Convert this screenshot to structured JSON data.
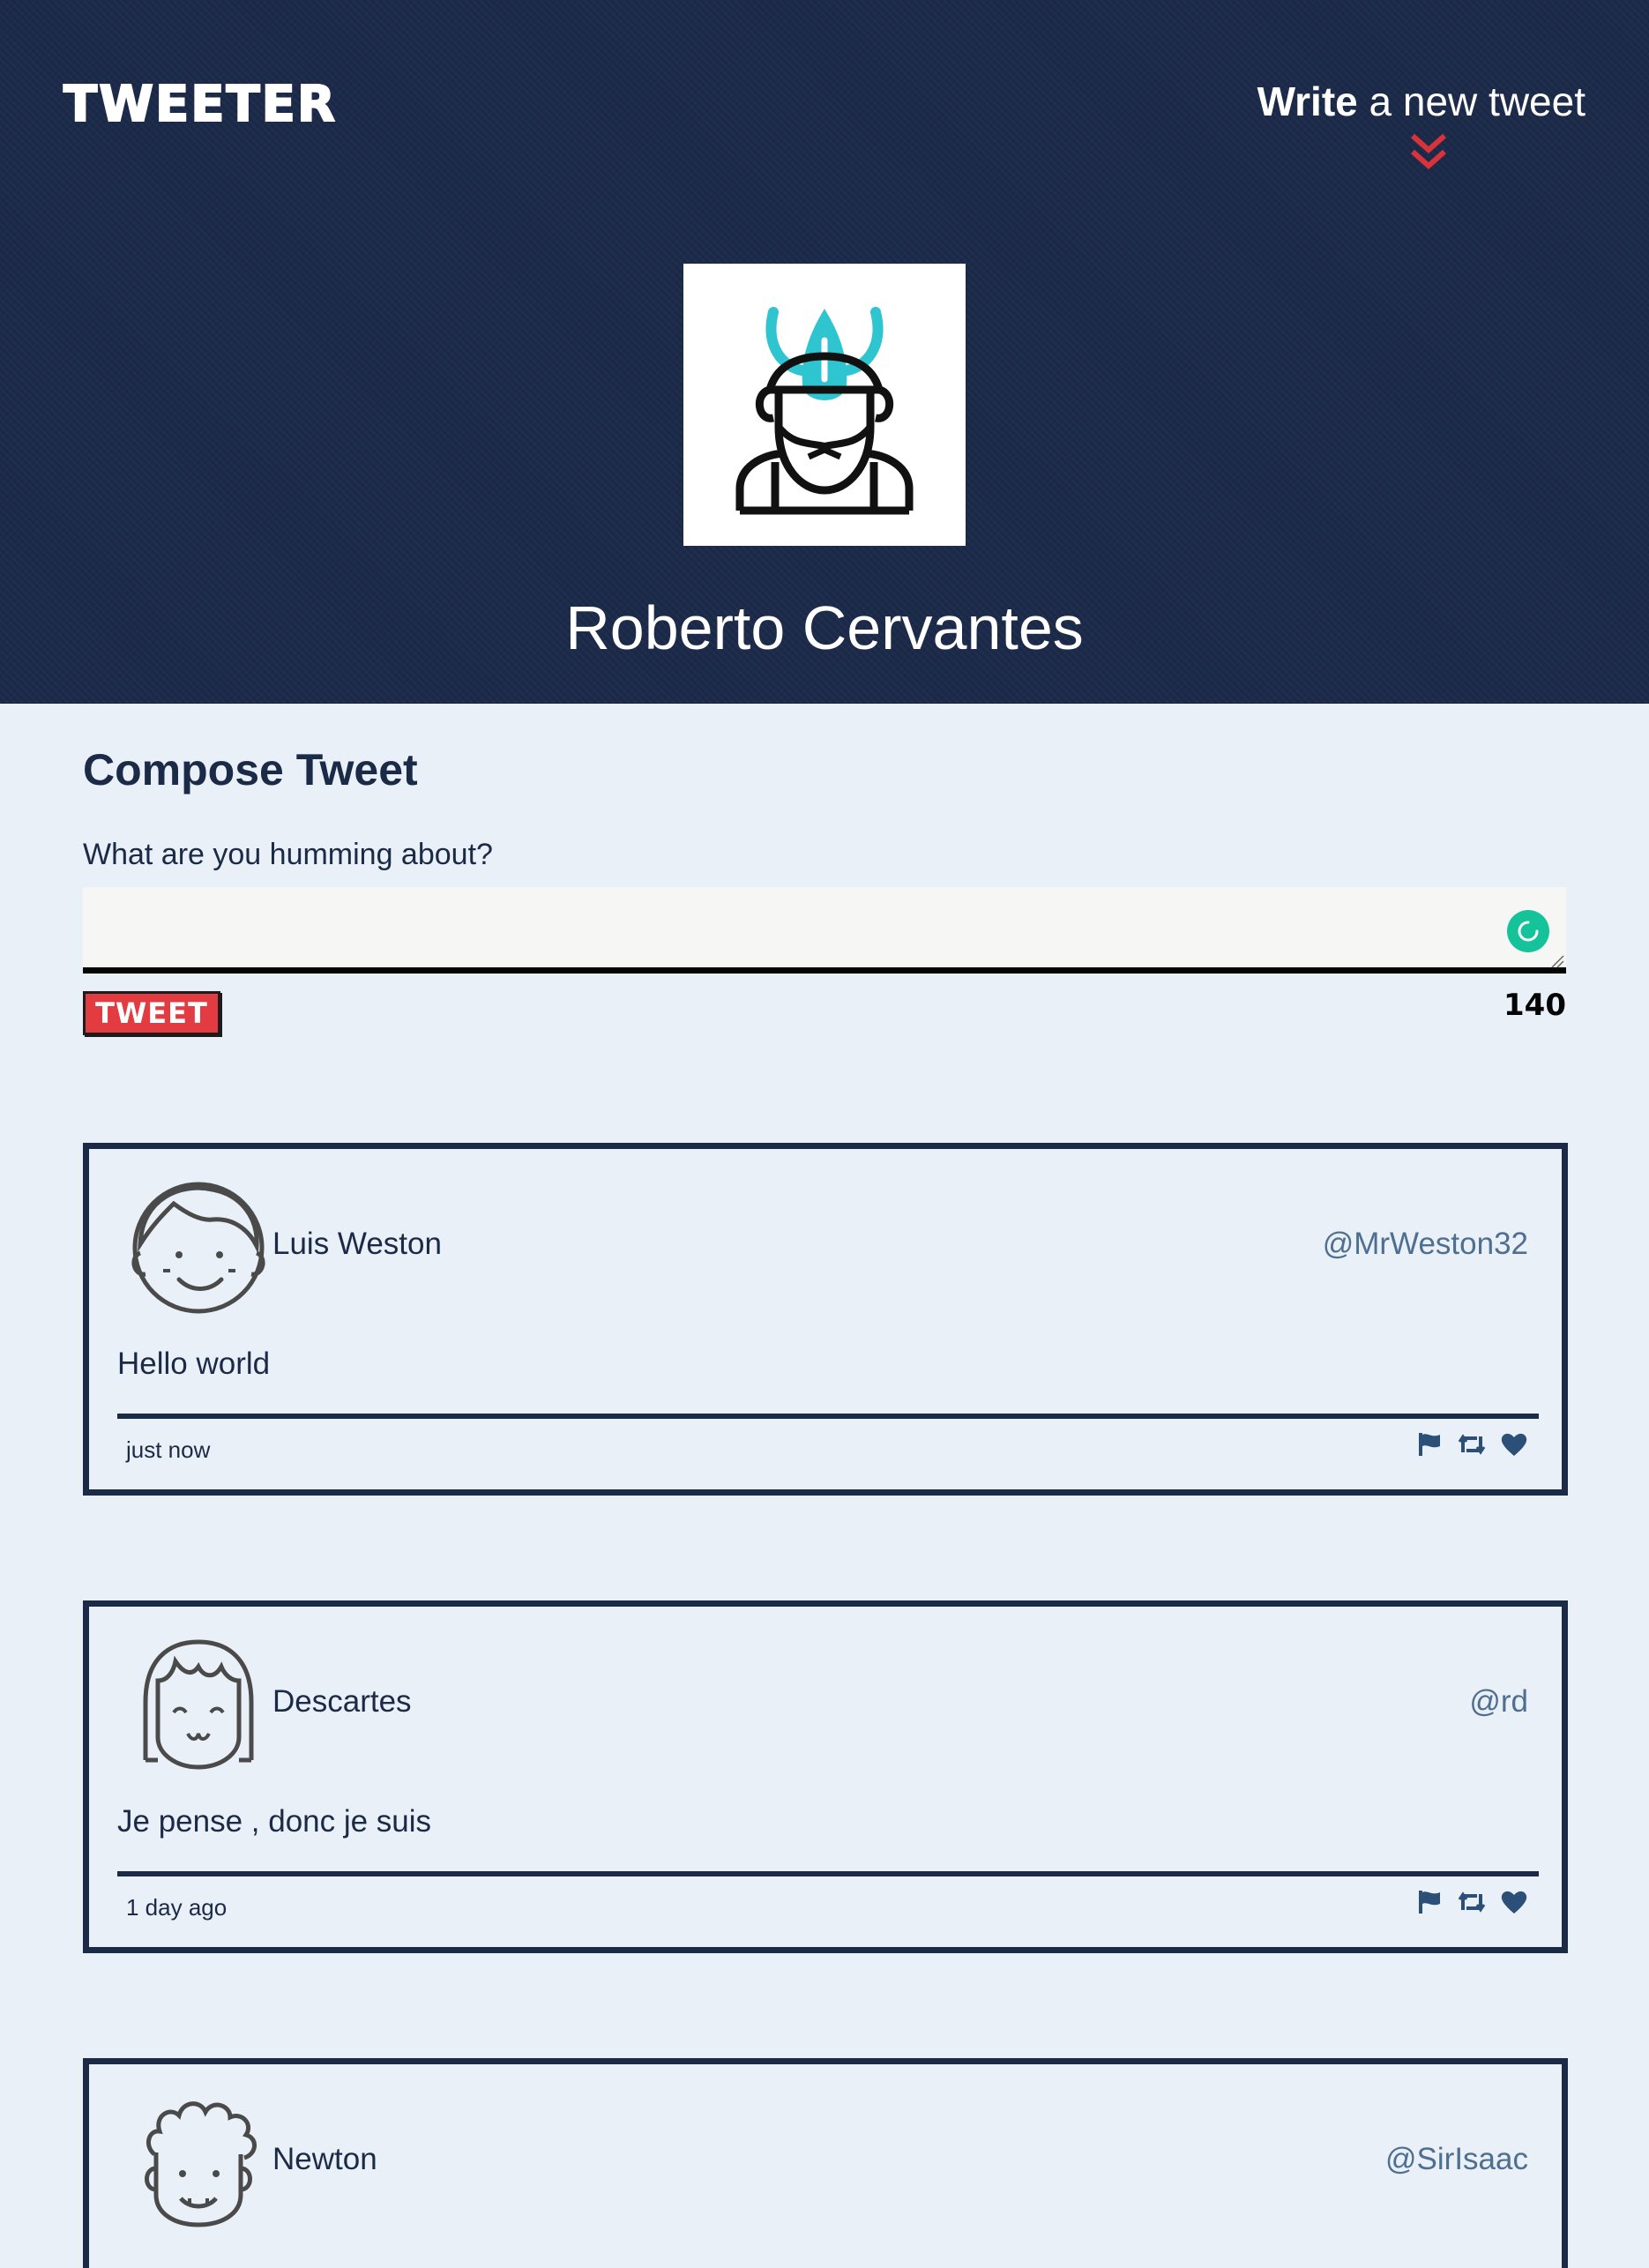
{
  "header": {
    "brand": "TWEETER",
    "write_bold": "Write",
    "write_rest": "a new tweet",
    "user_name": "Roberto Cervantes"
  },
  "compose": {
    "title": "Compose Tweet",
    "label": "What are you humming about?",
    "value": "",
    "button_label": "TWEET",
    "counter": "140"
  },
  "tweets": [
    {
      "name": "Luis Weston",
      "handle": "@MrWeston32",
      "body": "Hello world",
      "time": "just now",
      "avatar": "smiling-boy-avatar"
    },
    {
      "name": "Descartes",
      "handle": "@rd",
      "body": "Je pense , donc je suis",
      "time": "1 day ago",
      "avatar": "bangs-girl-avatar"
    },
    {
      "name": "Newton",
      "handle": "@SirIsaac",
      "body": "",
      "time": "",
      "avatar": "curly-hair-avatar"
    }
  ],
  "colors": {
    "header_bg": "#1c2a4a",
    "page_bg": "#e9f0f8",
    "accent_red": "#e23b41",
    "teal": "#2ec4d0",
    "grammar_green": "#15c39a",
    "handle": "#4f6f90"
  },
  "icons": [
    "double-chevron-down-icon",
    "viking-avatar-icon",
    "grammarly-icon",
    "flag-icon",
    "retweet-icon",
    "heart-icon"
  ]
}
